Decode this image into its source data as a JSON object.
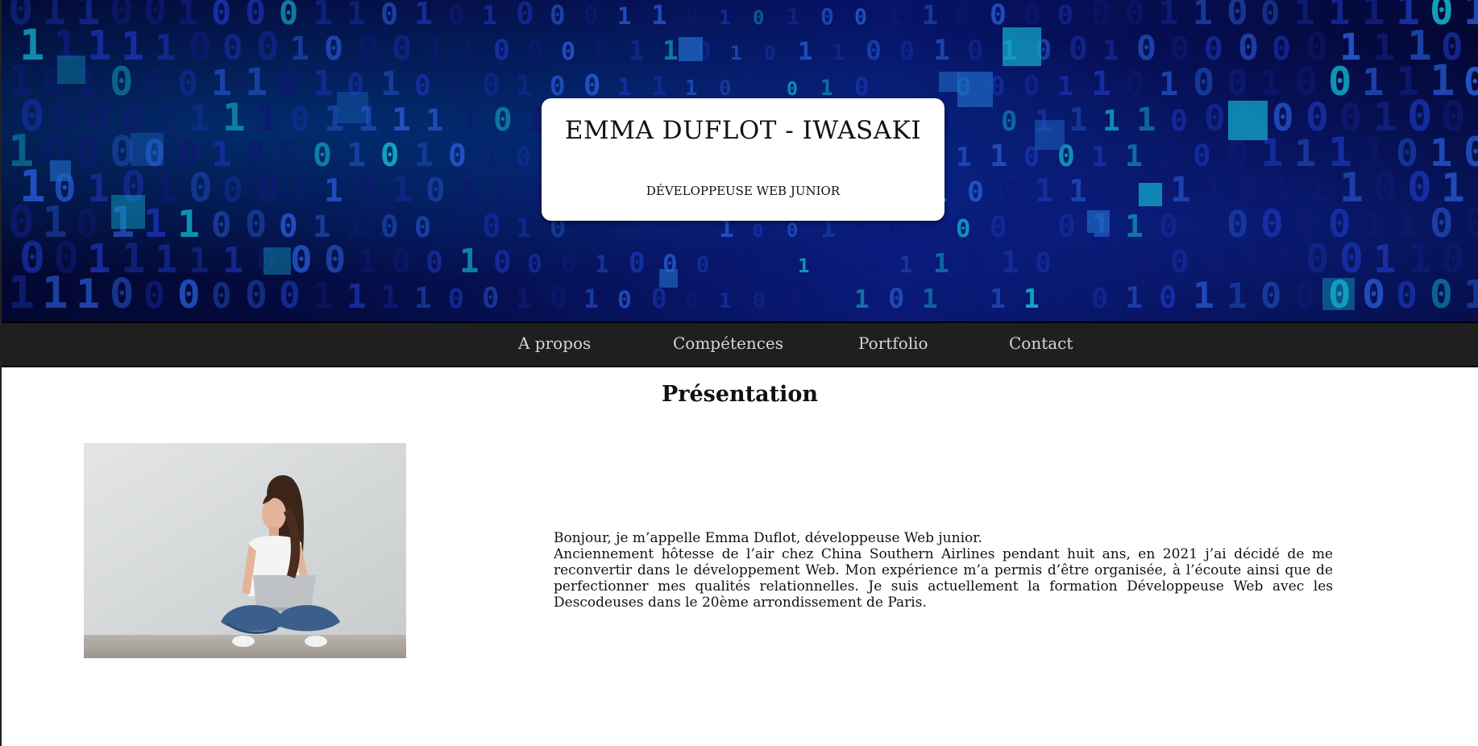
{
  "header": {
    "name": "EMMA DUFLOT - IWASAKI",
    "role": "DÉVELOPPEUSE WEB JUNIOR"
  },
  "nav": {
    "items": [
      {
        "label": "A propos"
      },
      {
        "label": "Compétences"
      },
      {
        "label": "Portfolio"
      },
      {
        "label": "Contact"
      }
    ]
  },
  "presentation": {
    "title": "Présentation",
    "bio_line1": "Bonjour, je m’appelle Emma Duflot, développeuse Web junior.",
    "bio_line2": "Anciennement hôtesse de l’air chez China Southern Airlines pendant huit ans, en 2021 j’ai décidé de me reconvertir dans le développement Web. Mon expérience m’a permis d’être organisée, à l’écoute ainsi que de perfectionner mes qualités relationnelles. Je suis actuellement la formation Développeuse Web avec les Descodeuses dans le 20ème arrondissement de Paris."
  },
  "colors": {
    "hero_dark": "#040a3a",
    "hero_accent": "#19c8ff",
    "nav_bg": "#1f1f1f",
    "nav_text": "#d6d6d6"
  },
  "icons": {
    "hero": "binary-code-background",
    "photo": "woman-with-laptop-photo"
  }
}
